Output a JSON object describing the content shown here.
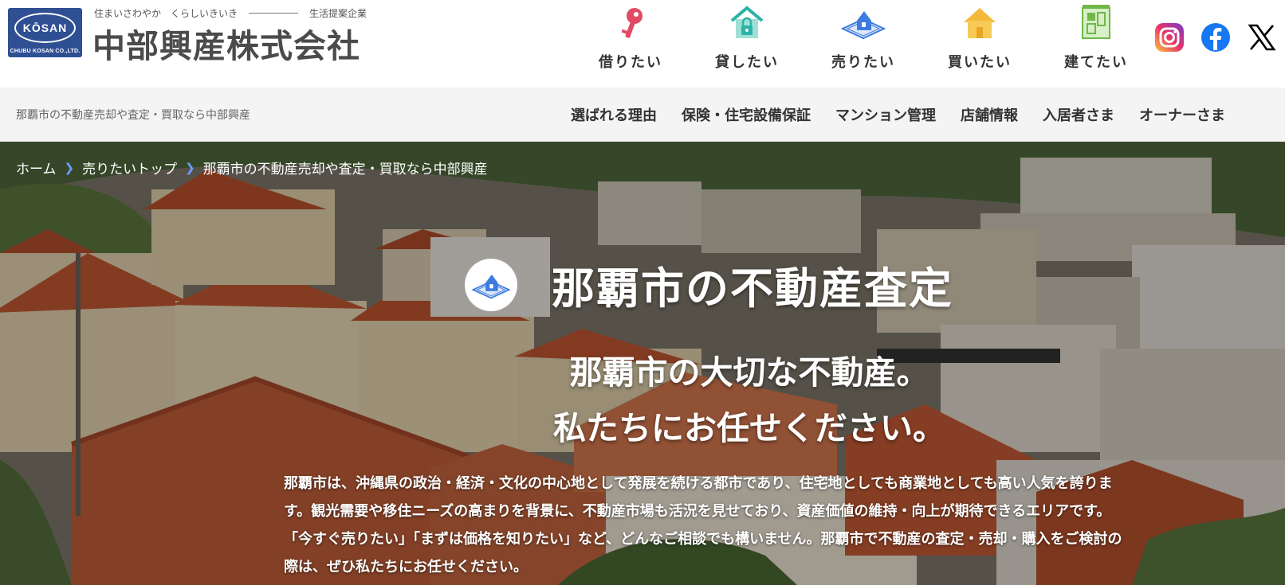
{
  "brand": {
    "logo_text": "KŌSAN",
    "logo_sub": "CHUBU KOSAN CO.,LTD.",
    "tagline_left": "住まいさわやか　くらしいきいき",
    "tagline_right": "生活提案企業",
    "company_name": "中部興産株式会社"
  },
  "icon_nav": [
    {
      "label": "借りたい",
      "icon": "key-icon"
    },
    {
      "label": "貸したい",
      "icon": "house-lock-icon"
    },
    {
      "label": "売りたい",
      "icon": "house-plot-icon"
    },
    {
      "label": "買いたい",
      "icon": "house-icon"
    },
    {
      "label": "建てたい",
      "icon": "building-plan-icon"
    }
  ],
  "social": [
    "instagram-icon",
    "facebook-icon",
    "x-icon"
  ],
  "subbar": {
    "page_caption": "那覇市の不動産売却や査定・買取なら中部興産",
    "menu": [
      "選ばれる理由",
      "保険・住宅設備保証",
      "マンション管理",
      "店舗情報",
      "入居者さま",
      "オーナーさま"
    ]
  },
  "breadcrumb": [
    "ホーム",
    "売りたいトップ",
    "那覇市の不動産売却や査定・買取なら中部興産"
  ],
  "hero": {
    "title": "那覇市の不動産査定",
    "catch_line1": "那覇市の大切な不動産。",
    "catch_line2": "私たちにお任せください。",
    "desc_line1": "那覇市は、沖縄県の政治・経済・文化の中心地として発展を続ける都市であり、住宅地としても商業地としても高い人気を誇りま",
    "desc_line2": "す。観光需要や移住ニーズの高まりを背景に、不動産市場も活況を見せており、資産価値の維持・向上が期待できるエリアです。",
    "desc_line3": "「今すぐ売りたい」「まずは価格を知りたい」など、どんなご相談でも構いません。那覇市で不動産の査定・売却・購入をご検討の",
    "desc_line4": "際は、ぜひ私たちにお任せください。"
  },
  "colors": {
    "brand_blue": "#2f4f93",
    "key_red": "#e24a63",
    "teal": "#2ab3a6",
    "sell_blue": "#3d7be0",
    "buy_yellow": "#f3b93a",
    "plan_green": "#6fb848",
    "roof": "#c7603a"
  }
}
